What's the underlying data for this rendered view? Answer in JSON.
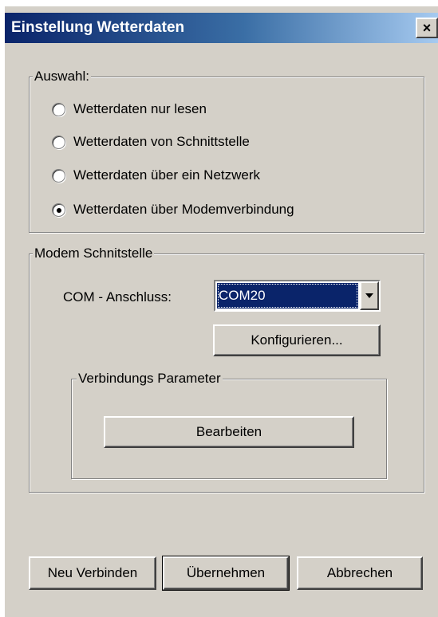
{
  "window": {
    "title": "Einstellung Wetterdaten",
    "close_label": "×"
  },
  "auswahl": {
    "legend": "Auswahl:",
    "options": [
      {
        "label": "Wetterdaten nur lesen",
        "checked": false
      },
      {
        "label": "Wetterdaten von Schnittstelle",
        "checked": false
      },
      {
        "label": "Wetterdaten über ein Netzwerk",
        "checked": false
      },
      {
        "label": "Wetterdaten über Modemverbindung",
        "checked": true
      }
    ]
  },
  "modem": {
    "legend": "Modem Schnitstelle",
    "com_label": "COM - Anschluss:",
    "com_value": "COM20",
    "configure_label": "Konfigurieren...",
    "params": {
      "legend": "Verbindungs Parameter",
      "edit_label": "Bearbeiten"
    }
  },
  "footer": {
    "reconnect_label": "Neu Verbinden",
    "apply_label": "Übernehmen",
    "cancel_label": "Abbrechen"
  },
  "colors": {
    "title_bar_start": "#0a246a",
    "title_bar_end": "#a6caf0",
    "dialog_face": "#d4d0c8",
    "selection": "#0a246a"
  }
}
